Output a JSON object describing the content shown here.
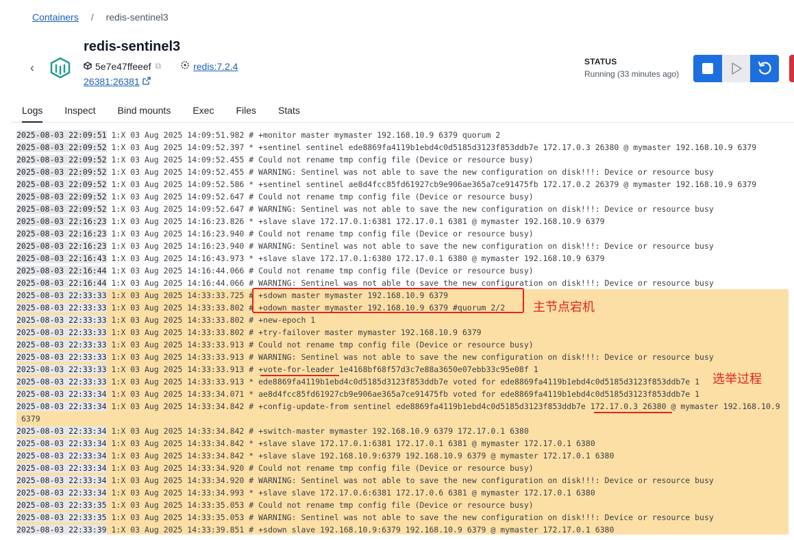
{
  "breadcrumb": {
    "parent": "Containers",
    "separator": "/",
    "current": "redis-sentinel3"
  },
  "container": {
    "name": "redis-sentinel3",
    "id": "5e7e47ffeeef",
    "image": "redis:7.2.4",
    "ports": "26381:26381"
  },
  "status": {
    "label": "STATUS",
    "text": "Running (33 minutes ago)"
  },
  "tabs": [
    "Logs",
    "Inspect",
    "Bind mounts",
    "Exec",
    "Files",
    "Stats"
  ],
  "logs": [
    {
      "ts": "2025-08-03 22:09:51",
      "msg": "1:X 03 Aug 2025 14:09:51.982 # +monitor master mymaster 192.168.10.9 6379 quorum 2"
    },
    {
      "ts": "2025-08-03 22:09:52",
      "msg": "1:X 03 Aug 2025 14:09:52.397 * +sentinel sentinel ede8869fa4119b1ebd4c0d5185d3123f853ddb7e 172.17.0.3 26380 @ mymaster 192.168.10.9 6379"
    },
    {
      "ts": "2025-08-03 22:09:52",
      "msg": "1:X 03 Aug 2025 14:09:52.455 # Could not rename tmp config file (Device or resource busy)"
    },
    {
      "ts": "2025-08-03 22:09:52",
      "msg": "1:X 03 Aug 2025 14:09:52.455 # WARNING: Sentinel was not able to save the new configuration on disk!!!: Device or resource busy"
    },
    {
      "ts": "2025-08-03 22:09:52",
      "msg": "1:X 03 Aug 2025 14:09:52.586 * +sentinel sentinel ae8d4fcc85fd61927cb9e906ae365a7ce91475fb 172.17.0.2 26379 @ mymaster 192.168.10.9 6379"
    },
    {
      "ts": "2025-08-03 22:09:52",
      "msg": "1:X 03 Aug 2025 14:09:52.647 # Could not rename tmp config file (Device or resource busy)"
    },
    {
      "ts": "2025-08-03 22:09:52",
      "msg": "1:X 03 Aug 2025 14:09:52.647 # WARNING: Sentinel was not able to save the new configuration on disk!!!: Device or resource busy"
    },
    {
      "ts": "2025-08-03 22:16:23",
      "msg": "1:X 03 Aug 2025 14:16:23.826 * +slave slave 172.17.0.1:6381 172.17.0.1 6381 @ mymaster 192.168.10.9 6379"
    },
    {
      "ts": "2025-08-03 22:16:23",
      "msg": "1:X 03 Aug 2025 14:16:23.940 # Could not rename tmp config file (Device or resource busy)"
    },
    {
      "ts": "2025-08-03 22:16:23",
      "msg": "1:X 03 Aug 2025 14:16:23.940 # WARNING: Sentinel was not able to save the new configuration on disk!!!: Device or resource busy"
    },
    {
      "ts": "2025-08-03 22:16:43",
      "msg": "1:X 03 Aug 2025 14:16:43.973 * +slave slave 172.17.0.1:6380 172.17.0.1 6380 @ mymaster 192.168.10.9 6379"
    },
    {
      "ts": "2025-08-03 22:16:44",
      "msg": "1:X 03 Aug 2025 14:16:44.066 # Could not rename tmp config file (Device or resource busy)"
    },
    {
      "ts": "2025-08-03 22:16:44",
      "msg": "1:X 03 Aug 2025 14:16:44.066 # WARNING: Sentinel was not able to save the new configuration on disk!!!: Device or resource busy"
    },
    {
      "ts": "2025-08-03 22:33:33",
      "msg": "1:X 03 Aug 2025 14:33:33.725 # +sdown master mymaster 192.168.10.9 6379"
    },
    {
      "ts": "2025-08-03 22:33:33",
      "msg": "1:X 03 Aug 2025 14:33:33.802 # +odown master mymaster 192.168.10.9 6379 #quorum 2/2"
    },
    {
      "ts": "2025-08-03 22:33:33",
      "msg": "1:X 03 Aug 2025 14:33:33.802 # +new-epoch 1"
    },
    {
      "ts": "2025-08-03 22:33:33",
      "msg": "1:X 03 Aug 2025 14:33:33.802 # +try-failover master mymaster 192.168.10.9 6379"
    },
    {
      "ts": "2025-08-03 22:33:33",
      "msg": "1:X 03 Aug 2025 14:33:33.913 # Could not rename tmp config file (Device or resource busy)"
    },
    {
      "ts": "2025-08-03 22:33:33",
      "msg": "1:X 03 Aug 2025 14:33:33.913 # WARNING: Sentinel was not able to save the new configuration on disk!!!: Device or resource busy"
    },
    {
      "ts": "2025-08-03 22:33:33",
      "msg": "1:X 03 Aug 2025 14:33:33.913 # +vote-for-leader 1e4168bf68f57d3c7e88a3650e07ebb33c95e08f 1"
    },
    {
      "ts": "2025-08-03 22:33:33",
      "msg": "1:X 03 Aug 2025 14:33:33.913 * ede8869fa4119b1ebd4c0d5185d3123f853ddb7e voted for ede8869fa4119b1ebd4c0d5185d3123f853ddb7e 1"
    },
    {
      "ts": "2025-08-03 22:33:34",
      "msg": "1:X 03 Aug 2025 14:33:34.071 * ae8d4fcc85fd61927cb9e906ae365a7ce91475fb voted for ede8869fa4119b1ebd4c0d5185d3123f853ddb7e 1"
    },
    {
      "ts": "2025-08-03 22:33:34",
      "msg": "1:X 03 Aug 2025 14:33:34.842 # +config-update-from sentinel ede8869fa4119b1ebd4c0d5185d3123f853ddb7e 172.17.0.3 26380 @ mymaster 192.168.10.9",
      "wrap": "6379"
    },
    {
      "ts": "2025-08-03 22:33:34",
      "msg": "1:X 03 Aug 2025 14:33:34.842 # +switch-master mymaster 192.168.10.9 6379 172.17.0.1 6380"
    },
    {
      "ts": "2025-08-03 22:33:34",
      "msg": "1:X 03 Aug 2025 14:33:34.842 * +slave slave 172.17.0.1:6381 172.17.0.1 6381 @ mymaster 172.17.0.1 6380"
    },
    {
      "ts": "2025-08-03 22:33:34",
      "msg": "1:X 03 Aug 2025 14:33:34.842 * +slave slave 192.168.10.9:6379 192.168.10.9 6379 @ mymaster 172.17.0.1 6380"
    },
    {
      "ts": "2025-08-03 22:33:34",
      "msg": "1:X 03 Aug 2025 14:33:34.920 # Could not rename tmp config file (Device or resource busy)"
    },
    {
      "ts": "2025-08-03 22:33:34",
      "msg": "1:X 03 Aug 2025 14:33:34.920 # WARNING: Sentinel was not able to save the new configuration on disk!!!: Device or resource busy"
    },
    {
      "ts": "2025-08-03 22:33:34",
      "msg": "1:X 03 Aug 2025 14:33:34.993 * +slave slave 172.17.0.6:6381 172.17.0.6 6381 @ mymaster 172.17.0.1 6380"
    },
    {
      "ts": "2025-08-03 22:33:35",
      "msg": "1:X 03 Aug 2025 14:33:35.053 # Could not rename tmp config file (Device or resource busy)"
    },
    {
      "ts": "2025-08-03 22:33:35",
      "msg": "1:X 03 Aug 2025 14:33:35.053 # WARNING: Sentinel was not able to save the new configuration on disk!!!: Device or resource busy"
    },
    {
      "ts": "2025-08-03 22:33:39",
      "msg": "1:X 03 Aug 2025 14:33:39.851 # +sdown slave 192.168.10.9:6379 192.168.10.9 6379 @ mymaster 172.17.0.1 6380"
    }
  ],
  "annotations": {
    "master_down": "主节点宕机",
    "election": "选举过程"
  },
  "colors": {
    "accent": "#1d6fe0",
    "highlight": "#fcdfa5",
    "annotation": "#e5231b",
    "danger": "#d6303a"
  }
}
